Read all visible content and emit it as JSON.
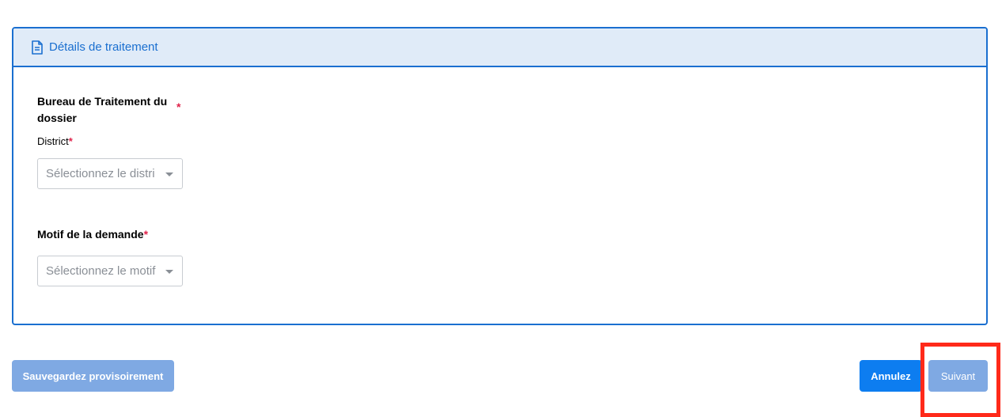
{
  "card": {
    "header_title": "Détails de traitement",
    "icon": "document-icon"
  },
  "bureau": {
    "title": "Bureau de Traitement du dossier",
    "required_mark": "*",
    "district_label": "District",
    "district_required_mark": "*",
    "district_placeholder": "Sélectionnez le distri"
  },
  "motif": {
    "title": "Motif de la demande",
    "required_mark": "*",
    "placeholder": "Sélectionnez le motif"
  },
  "actions": {
    "save_label": "Sauvegardez provisoirement",
    "cancel_label": "Annulez",
    "next_label": "Suivant"
  },
  "colors": {
    "accent": "#1a6fd0",
    "header_bg": "#e0ebf8",
    "required": "#e0224a",
    "button_primary": "#0d7df0",
    "button_disabled": "#7fa9e3",
    "highlight": "#ff2a1a"
  }
}
